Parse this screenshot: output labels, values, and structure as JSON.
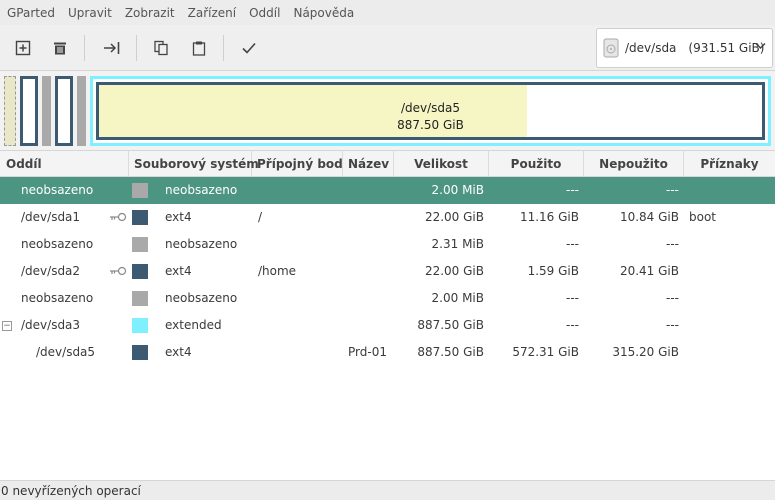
{
  "menu": [
    "GParted",
    "Upravit",
    "Zobrazit",
    "Zařízení",
    "Oddíl",
    "Nápověda"
  ],
  "toolbar": {
    "icons": [
      "new-partition-icon",
      "delete-icon",
      "resize-move-icon",
      "copy-icon",
      "paste-icon",
      "apply-icon"
    ]
  },
  "device": {
    "name": "/dev/sda",
    "size": "(931.51 GiB)"
  },
  "map": {
    "sda5_label": "/dev/sda5",
    "sda5_size": "887.50 GiB",
    "sda5_used_fraction": 0.645
  },
  "columns": [
    "Oddíl",
    "Souborový systém",
    "Přípojný bod",
    "Název",
    "Velikost",
    "Použito",
    "Nepoužito",
    "Příznaky"
  ],
  "rows": [
    {
      "partition": "neobsazeno",
      "fs": "neobsazeno",
      "mount": "",
      "name": "",
      "size": "2.00 MiB",
      "used": "---",
      "unused": "---",
      "flags": "",
      "color": "#a9a9a9"
    },
    {
      "partition": "/dev/sda1",
      "fs": "ext4",
      "mount": "/",
      "name": "",
      "size": "22.00 GiB",
      "used": "11.16 GiB",
      "unused": "10.84 GiB",
      "flags": "boot",
      "color": "#3d5a73"
    },
    {
      "partition": "neobsazeno",
      "fs": "neobsazeno",
      "mount": "",
      "name": "",
      "size": "2.31 MiB",
      "used": "---",
      "unused": "---",
      "flags": "",
      "color": "#a9a9a9"
    },
    {
      "partition": "/dev/sda2",
      "fs": "ext4",
      "mount": "/home",
      "name": "",
      "size": "22.00 GiB",
      "used": "1.59 GiB",
      "unused": "20.41 GiB",
      "flags": "",
      "color": "#3d5a73"
    },
    {
      "partition": "neobsazeno",
      "fs": "neobsazeno",
      "mount": "",
      "name": "",
      "size": "2.00 MiB",
      "used": "---",
      "unused": "---",
      "flags": "",
      "color": "#a9a9a9"
    },
    {
      "partition": "/dev/sda3",
      "fs": "extended",
      "mount": "",
      "name": "",
      "size": "887.50 GiB",
      "used": "---",
      "unused": "---",
      "flags": "",
      "color": "#7ff0ff"
    },
    {
      "partition": "/dev/sda5",
      "fs": "ext4",
      "mount": "",
      "name": "Prd-01",
      "size": "887.50 GiB",
      "used": "572.31 GiB",
      "unused": "315.20 GiB",
      "flags": "",
      "color": "#3d5a73"
    }
  ],
  "status": "0 nevyřízených operací"
}
